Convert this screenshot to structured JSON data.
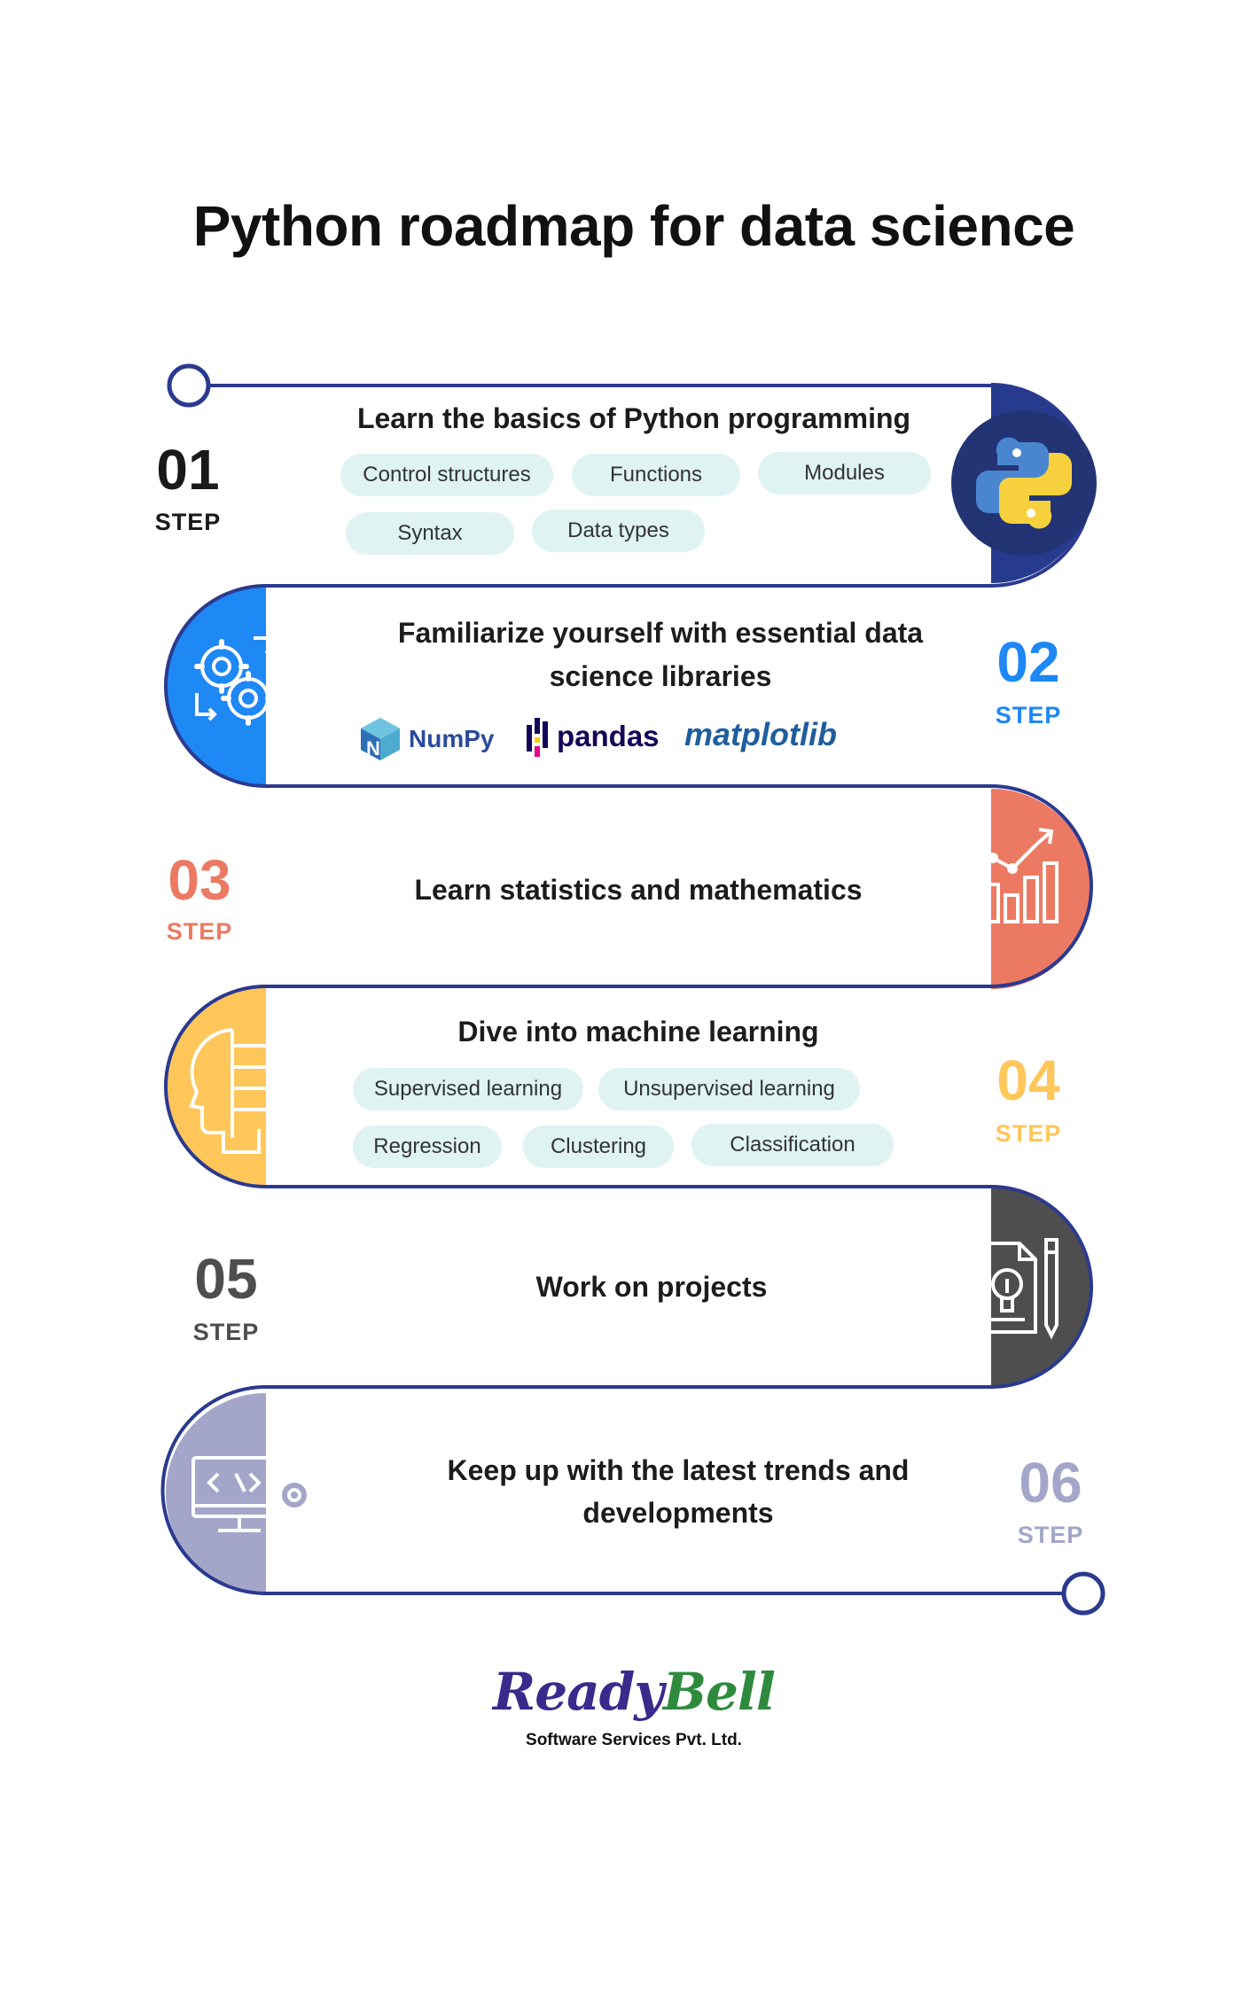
{
  "title": "Python roadmap for data science",
  "step_word": "STEP",
  "colors": {
    "path_line": "#2b3a8f",
    "step1": "#263b8e",
    "step2": "#1e88f5",
    "step3": "#ec7a63",
    "step4": "#ffc65a",
    "step5": "#4e4e4e",
    "step6": "#a3a6c9",
    "pill_bg": "#dff3f3",
    "brand_ready": "#3a2a8c",
    "brand_bell": "#2e8b3e"
  },
  "steps": [
    {
      "number": "01",
      "heading": "Learn the basics of Python programming",
      "icon": "python-logo-icon",
      "pills": [
        "Control structures",
        "Functions",
        "Modules",
        "Syntax",
        "Data types"
      ]
    },
    {
      "number": "02",
      "heading_line1": "Familiarize yourself with essential data",
      "heading_line2": "science libraries",
      "icon": "gears-icon",
      "libraries": [
        "NumPy",
        "pandas",
        "matplotlib"
      ]
    },
    {
      "number": "03",
      "heading": "Learn statistics and mathematics",
      "icon": "growth-chart-icon"
    },
    {
      "number": "04",
      "heading": "Dive into machine learning",
      "icon": "ai-head-icon",
      "pills": [
        "Supervised learning",
        "Unsupervised learning",
        "Regression",
        "Clustering",
        "Classification"
      ]
    },
    {
      "number": "05",
      "heading": "Work on projects",
      "icon": "project-idea-icon"
    },
    {
      "number": "06",
      "heading_line1": "Keep up with the latest trends and",
      "heading_line2": "developments",
      "icon": "code-monitor-icon"
    }
  ],
  "brand": {
    "ready": "Ready",
    "bell": "Bell",
    "subtitle": "Software Services Pvt. Ltd."
  }
}
